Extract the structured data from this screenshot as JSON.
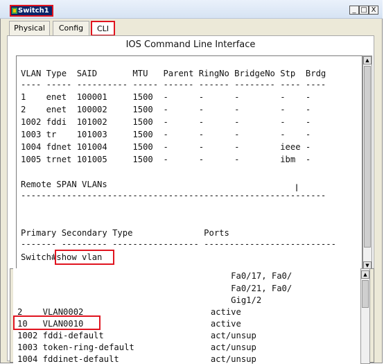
{
  "window": {
    "title": "Switch1",
    "minimize": "_",
    "maximize": "□",
    "close": "X"
  },
  "tabs": [
    "Physical",
    "Config",
    "CLI"
  ],
  "panel_title": "IOS Command Line Interface",
  "cli_top": {
    "lines": [
      "VLAN Type  SAID       MTU   Parent RingNo BridgeNo Stp  Brdg",
      "---- ----- ---------- ----- ------ ------ -------- ---- ----",
      "1    enet  100001     1500  -      -      -        -    -",
      "2    enet  100002     1500  -      -      -        -    -",
      "1002 fddi  101002     1500  -      -      -        -    -",
      "1003 tr    101003     1500  -      -      -        -    -",
      "1004 fdnet 101004     1500  -      -      -        ieee -",
      "1005 trnet 101005     1500  -      -      -        ibm  -",
      "",
      "Remote SPAN VLANs",
      "------------------------------------------------------------",
      "",
      "",
      "Primary Secondary Type              Ports",
      "------- --------- ----------------- --------------------------"
    ],
    "prompt": "Switch#show vlan"
  },
  "cli_bottom": {
    "lines": [
      "                                          Fa0/17, Fa0/",
      "                                          Fa0/21, Fa0/",
      "                                          Gig1/2",
      "2    VLAN0002                         active",
      "10   VLAN0010                         active",
      "1002 fddi-default                     act/unsup",
      "1003 token-ring-default               act/unsup",
      "1004 fddinet-default                  act/unsup"
    ]
  },
  "cursor": "I"
}
